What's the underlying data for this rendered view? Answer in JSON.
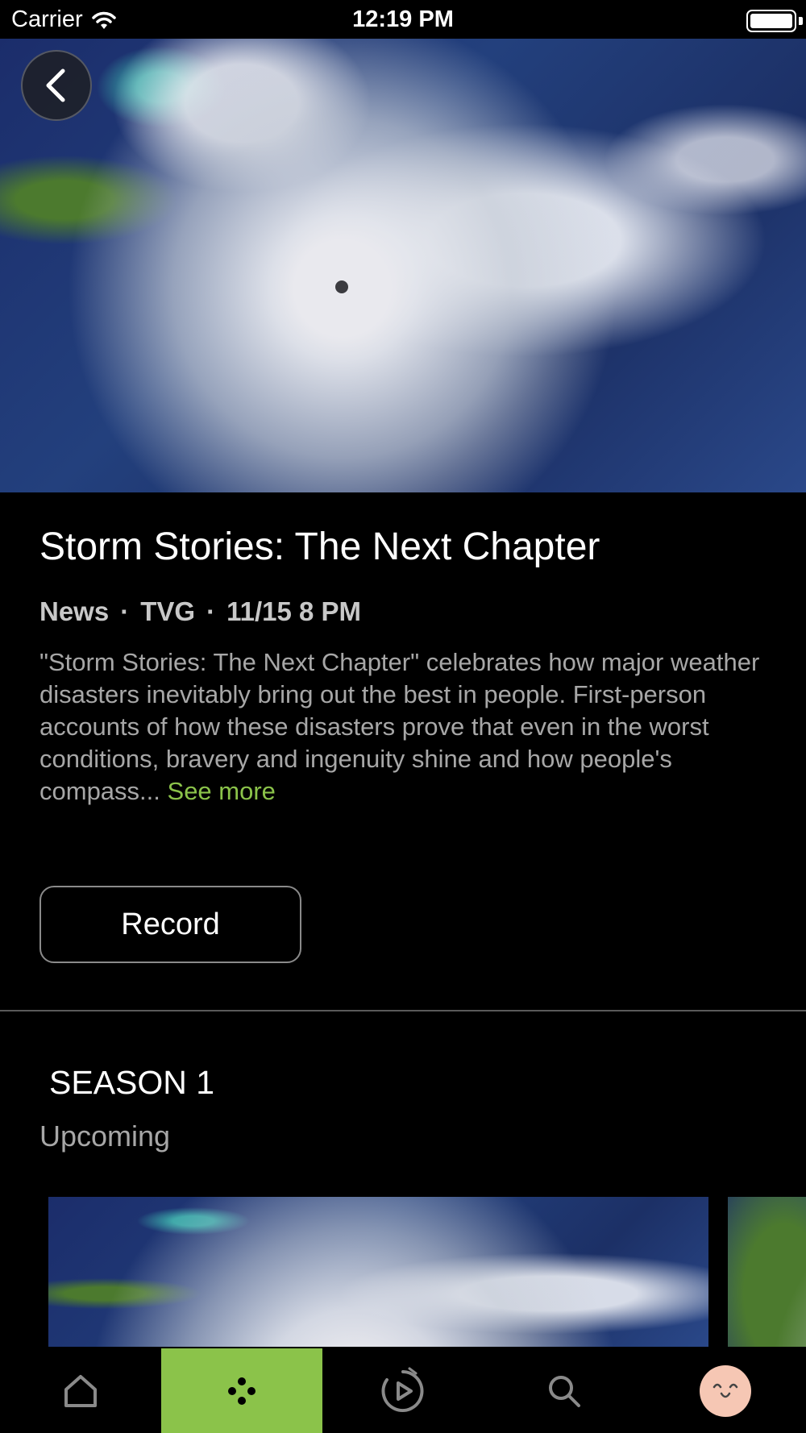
{
  "status_bar": {
    "carrier": "Carrier",
    "time": "12:19 PM"
  },
  "program": {
    "title": "Storm Stories: The Next Chapter",
    "genre": "News",
    "rating": "TVG",
    "airing": "11/15 8 PM",
    "separator": "·",
    "description": "\"Storm Stories: The Next Chapter\" celebrates how major weather disasters inevitably bring out the best in people. First-person accounts of how these disasters prove that even in the worst conditions, bravery and ingenuity shine and how people's compass...",
    "see_more_label": "See more",
    "record_label": "Record"
  },
  "season": {
    "title": "SEASON 1",
    "subtitle": "Upcoming"
  },
  "tab_bar": {
    "items": [
      {
        "icon": "home-icon",
        "active": false
      },
      {
        "icon": "grid-dots-icon",
        "active": true
      },
      {
        "icon": "replay-play-icon",
        "active": false
      },
      {
        "icon": "search-icon",
        "active": false
      },
      {
        "icon": "profile-avatar-icon",
        "active": false
      }
    ]
  },
  "colors": {
    "accent": "#8bc34a",
    "background": "#000000",
    "secondary_text": "#a7a7a7"
  }
}
